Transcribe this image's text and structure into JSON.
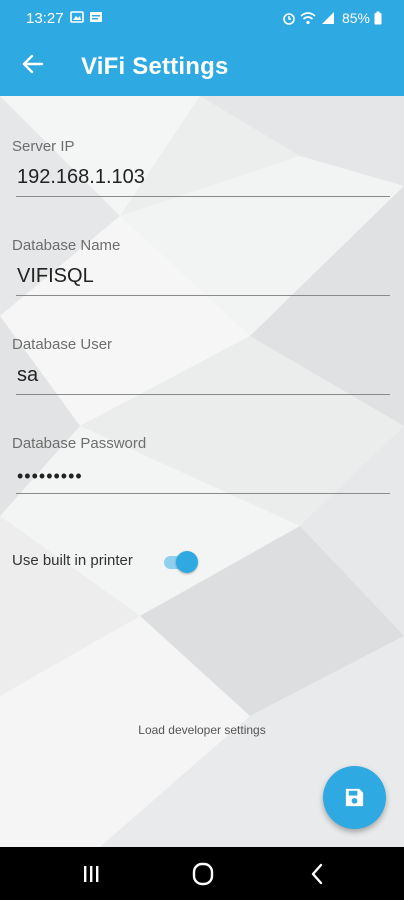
{
  "status_bar": {
    "time": "13:27",
    "battery": "85%",
    "icons": [
      "gallery-icon",
      "message-icon",
      "alarm-icon",
      "wifi-icon",
      "signal-icon",
      "battery-icon"
    ]
  },
  "app_bar": {
    "title": "ViFi Settings",
    "back_icon": "arrow-left-icon"
  },
  "form": {
    "server_ip": {
      "label": "Server IP",
      "value": "192.168.1.103"
    },
    "database_name": {
      "label": "Database Name",
      "value": "VIFISQL"
    },
    "database_user": {
      "label": "Database User",
      "value": "sa"
    },
    "database_password": {
      "label": "Database Password",
      "value": "•••••••••"
    }
  },
  "printer": {
    "label": "Use built in printer",
    "enabled": true
  },
  "developer_link": "Load developer settings",
  "fab": {
    "icon": "save-icon"
  },
  "nav_bar": {
    "icons": [
      "recents-icon",
      "home-icon",
      "back-icon"
    ]
  },
  "colors": {
    "accent": "#2fa9e1",
    "toggle_track": "#8fd0ef"
  }
}
